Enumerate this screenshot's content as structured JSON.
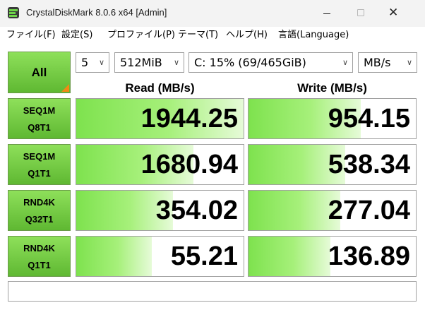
{
  "window": {
    "title": "CrystalDiskMark 8.0.6 x64 [Admin]"
  },
  "menu": [
    "ファイル(F)",
    "設定(S)",
    "プロファイル(P)",
    "テーマ(T)",
    "ヘルプ(H)",
    "言語(Language)"
  ],
  "controls": {
    "all_label": "All",
    "count": "5",
    "size": "512MiB",
    "drive": "C: 15% (69/465GiB)",
    "unit": "MB/s"
  },
  "headers": {
    "read": "Read (MB/s)",
    "write": "Write (MB/s)"
  },
  "rows": [
    {
      "line1": "SEQ1M",
      "line2": "Q8T1",
      "read": "1944.25",
      "write": "954.15",
      "read_fill": 1.0,
      "write_fill": 0.67
    },
    {
      "line1": "SEQ1M",
      "line2": "Q1T1",
      "read": "1680.94",
      "write": "538.34",
      "read_fill": 0.7,
      "write_fill": 0.58
    },
    {
      "line1": "RND4K",
      "line2": "Q32T1",
      "read": "354.02",
      "write": "277.04",
      "read_fill": 0.58,
      "write_fill": 0.55
    },
    {
      "line1": "RND4K",
      "line2": "Q1T1",
      "read": "55.21",
      "write": "136.89",
      "read_fill": 0.45,
      "write_fill": 0.49
    }
  ],
  "comment": "",
  "colors": {
    "button_green": "#6fd040",
    "bar_green": "#7ee24e",
    "corner_orange": "#f08a14"
  }
}
